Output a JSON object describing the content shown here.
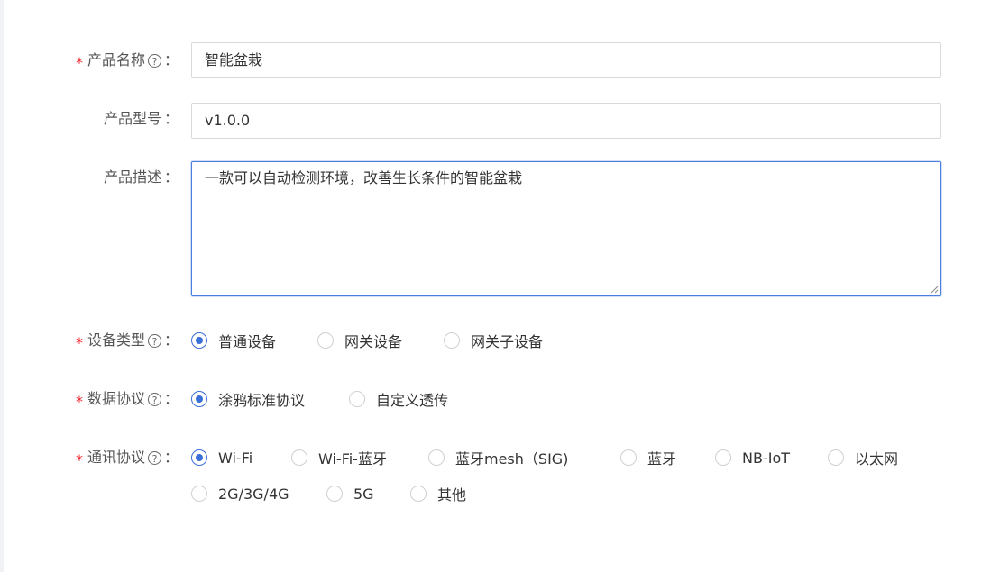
{
  "form": {
    "product_name": {
      "label": "产品名称",
      "required": true,
      "help": "?",
      "value": "智能盆栽"
    },
    "product_model": {
      "label": "产品型号",
      "required": false,
      "value": "v1.0.0"
    },
    "product_desc": {
      "label": "产品描述",
      "required": false,
      "value": "一款可以自动检测环境，改善生长条件的智能盆栽"
    },
    "device_type": {
      "label": "设备类型",
      "required": true,
      "help": "?",
      "options": [
        "普通设备",
        "网关设备",
        "网关子设备"
      ],
      "selected": "普通设备"
    },
    "data_protocol": {
      "label": "数据协议",
      "required": true,
      "help": "?",
      "options": [
        "涂鸦标准协议",
        "自定义透传"
      ],
      "selected": "涂鸦标准协议"
    },
    "comm_protocol": {
      "label": "通讯协议",
      "required": true,
      "help": "?",
      "options": [
        "Wi-Fi",
        "Wi-Fi-蓝牙",
        "蓝牙mesh（SIG)",
        "蓝牙",
        "NB-IoT",
        "以太网",
        "2G/3G/4G",
        "5G",
        "其他"
      ],
      "selected": "Wi-Fi"
    },
    "colon": "：",
    "required_mark": "*"
  },
  "colors": {
    "accent": "#3a6fd8",
    "required": "#f5222d",
    "border": "#d9d9d9"
  }
}
